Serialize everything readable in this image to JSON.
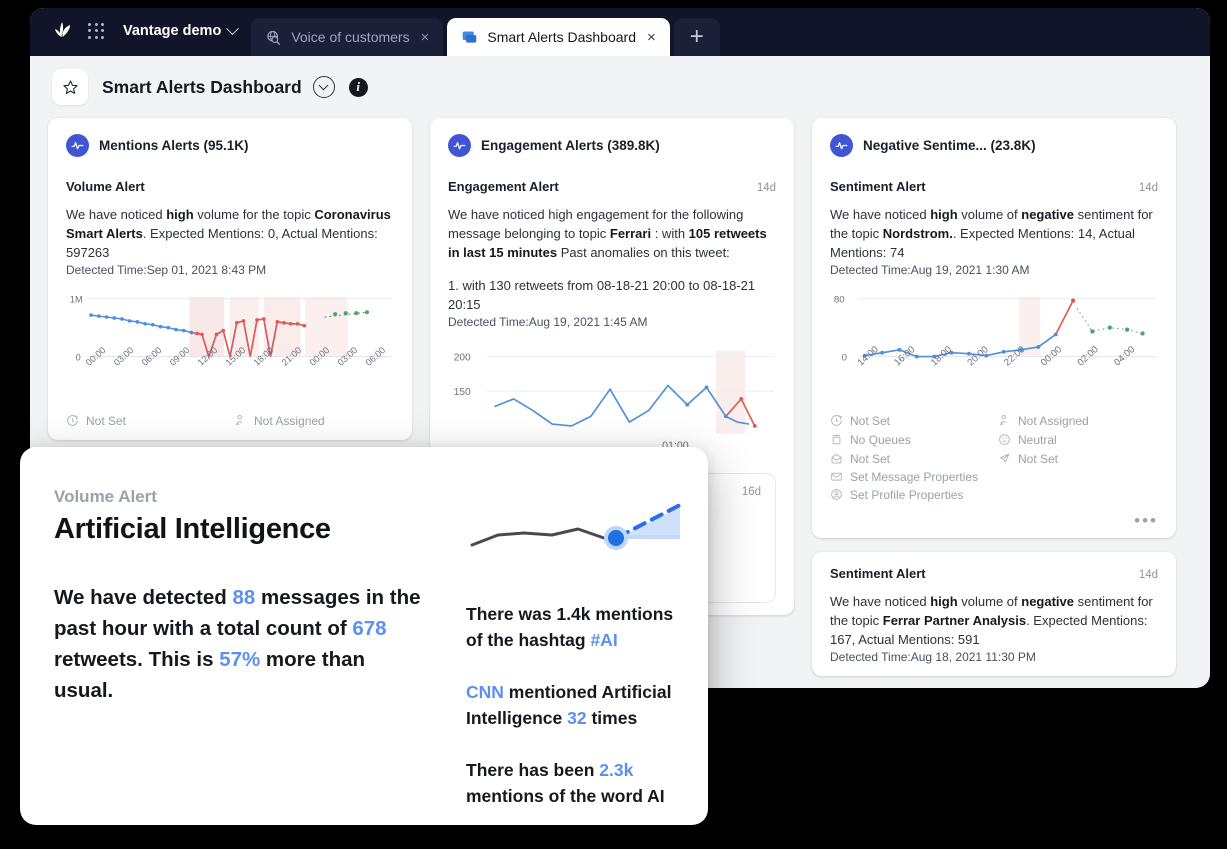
{
  "browser": {
    "workspace": {
      "label": "Vantage demo",
      "icon": "chevron-down-icon"
    },
    "logo_name": "sprinklr-logo",
    "apps_grid_name": "apps-grid-icon",
    "tabs": [
      {
        "label": "Voice of customers",
        "icon": "globe-search-icon",
        "active": false,
        "close": "×"
      },
      {
        "label": "Smart Alerts Dashboard",
        "icon": "chat-bubble-icon",
        "active": true,
        "close": "×"
      }
    ],
    "new_tab_label": "+"
  },
  "header": {
    "star_icon": "star-outline-icon",
    "title": "Smart Alerts Dashboard",
    "dropdown_icon": "chevron-down-circle-icon",
    "info_label": "i"
  },
  "columns": [
    {
      "id": "mentions",
      "head_title": "Mentions Alerts (95.1K)",
      "cards": [
        {
          "kind": "Volume Alert",
          "age": "",
          "body_parts": [
            {
              "t": "We have noticed ",
              "b": false
            },
            {
              "t": "high",
              "b": true
            },
            {
              "t": " volume for the topic ",
              "b": false
            },
            {
              "t": "Coronavirus Smart Alerts",
              "b": true
            },
            {
              "t": ". Expected Mentions: 0, Actual Mentions: 597263",
              "b": false
            }
          ],
          "detected": "Detected Time:Sep 01, 2021 8:43 PM",
          "meta_left": [
            {
              "icon": "clock-arrow-icon",
              "label": "Not Set"
            }
          ],
          "meta_right": [
            {
              "icon": "person-assign-icon",
              "label": "Not Assigned"
            }
          ]
        }
      ]
    },
    {
      "id": "engagement",
      "head_title": "Engagement Alerts (389.8K)",
      "cards": [
        {
          "kind": "Engagement Alert",
          "age": "14d",
          "body_parts": [
            {
              "t": "We have noticed high engagement for the following message belonging to topic ",
              "b": false
            },
            {
              "t": "Ferrari",
              "b": true
            },
            {
              "t": " :  with ",
              "b": false
            },
            {
              "t": "105 retweets in last 15 minutes",
              "b": true
            },
            {
              "t": "\nPast anomalies on this tweet:",
              "b": false
            }
          ],
          "anomaly": "1.  with 130 retweets from 08-18-21 20:00 to 08-18-21 20:15",
          "detected": "Detected Time:Aug 19, 2021 1:45 AM",
          "inner_quote": {
            "age": "16d",
            "link": "mZb"
          }
        }
      ]
    },
    {
      "id": "negative-sentiment",
      "head_title": "Negative Sentime...   (23.8K)",
      "cards": [
        {
          "kind": "Sentiment Alert",
          "age": "14d",
          "body_parts": [
            {
              "t": "We have noticed ",
              "b": false
            },
            {
              "t": "high",
              "b": true
            },
            {
              "t": " volume of ",
              "b": false
            },
            {
              "t": "negative",
              "b": true
            },
            {
              "t": " sentiment for the topic ",
              "b": false
            },
            {
              "t": "Nordstrom.",
              "b": true
            },
            {
              "t": ". Expected Mentions: 14, Actual Mentions: 74",
              "b": false
            }
          ],
          "detected": "Detected Time:Aug 19, 2021 1:30 AM",
          "meta_left": [
            {
              "icon": "clock-arrow-icon",
              "label": "Not Set"
            },
            {
              "icon": "queue-icon",
              "label": "No Queues"
            },
            {
              "icon": "inbox-icon",
              "label": "Not Set"
            }
          ],
          "meta_right": [
            {
              "icon": "person-assign-icon",
              "label": "Not Assigned"
            },
            {
              "icon": "neutral-face-icon",
              "label": "Neutral"
            },
            {
              "icon": "paper-plane-icon",
              "label": "Not Set"
            }
          ],
          "meta_full": [
            {
              "icon": "envelope-icon",
              "label": "Set Message Properties"
            },
            {
              "icon": "user-circle-icon",
              "label": "Set Profile Properties"
            }
          ],
          "more_label": "•••"
        },
        {
          "kind": "Sentiment Alert",
          "age": "14d",
          "body_parts": [
            {
              "t": "We have noticed ",
              "b": false
            },
            {
              "t": "high",
              "b": true
            },
            {
              "t": " volume of ",
              "b": false
            },
            {
              "t": "negative",
              "b": true
            },
            {
              "t": " sentiment for the topic ",
              "b": false
            },
            {
              "t": "Ferrar Partner Analysis",
              "b": true
            },
            {
              "t": ". Expected Mentions: 167, Actual Mentions: 591",
              "b": false
            }
          ],
          "detected": "Detected Time:Aug 18, 2021 11:30 PM"
        }
      ]
    }
  ],
  "overlay": {
    "kicker": "Volume Alert",
    "title": "Artificial Intelligence",
    "paragraph": [
      {
        "t": "We have detected ",
        "hl": false
      },
      {
        "t": "88",
        "hl": true
      },
      {
        "t": " messages in the past hour with a total count of ",
        "hl": false
      },
      {
        "t": "678",
        "hl": true
      },
      {
        "t": " retweets. This is ",
        "hl": false
      },
      {
        "t": "57%",
        "hl": true
      },
      {
        "t": " more than usual.",
        "hl": false
      }
    ],
    "sparkline_name": "trend-sparkline",
    "stats": [
      [
        {
          "t": "There was 1.4k mentions of the hashtag ",
          "hl": false
        },
        {
          "t": "#AI",
          "hl": true
        }
      ],
      [
        {
          "t": "CNN",
          "hl": true
        },
        {
          "t": " mentioned Artificial Intelligence ",
          "hl": false
        },
        {
          "t": "32",
          "hl": true
        },
        {
          "t": " times",
          "hl": false
        }
      ],
      [
        {
          "t": "There has been ",
          "hl": false
        },
        {
          "t": "2.3k",
          "hl": true
        },
        {
          "t": " mentions of the word AI",
          "hl": false
        }
      ]
    ]
  },
  "colors": {
    "accent_blue": "#4155d4",
    "link_blue": "#4468d8",
    "highlight_blue": "#5b8ff0",
    "line_blue": "#4e90d9",
    "line_red": "#e05a52",
    "line_green": "#4aa663",
    "tabbar_dark": "#12152a",
    "page_bg": "#f2f3f5"
  },
  "chart_data": [
    {
      "id": "mentions-volume-chart",
      "type": "line",
      "title": "",
      "ylabel": "",
      "xlabel": "",
      "ytick_labels": [
        "1M",
        "0"
      ],
      "ylim": [
        0,
        1000000
      ],
      "categories": [
        "00:00",
        "03:00",
        "06:00",
        "09:00",
        "12:00",
        "15:00",
        "18:00",
        "21:00",
        "00:00",
        "03:00",
        "06:00"
      ],
      "series": [
        {
          "name": "actual-blue",
          "color": "#4e90d9",
          "values": [
            680000,
            660000,
            640000,
            620000,
            600000,
            580000,
            565000,
            545000,
            530000,
            510000,
            490000,
            470000,
            450000,
            430000,
            410000,
            395000,
            380000,
            370000,
            0,
            480000,
            530000,
            0,
            620000,
            660000,
            0,
            700000,
            720000,
            0,
            660000,
            640000,
            630000,
            615000,
            600000
          ]
        },
        {
          "name": "anomaly-red",
          "color": "#e05a52",
          "values": [
            null,
            null,
            null,
            null,
            null,
            null,
            null,
            null,
            null,
            null,
            null,
            null,
            null,
            null,
            null,
            380000,
            370000,
            0,
            null,
            480000,
            530000,
            null,
            620000,
            660000,
            null,
            700000,
            720000,
            null,
            660000,
            640000,
            630000,
            615000,
            600000
          ]
        },
        {
          "name": "forecast-green",
          "color": "#4aa663",
          "values": [
            720000,
            735000,
            735000,
            740000
          ]
        }
      ],
      "anomaly_bands": [
        "12:00-05:00"
      ]
    },
    {
      "id": "engagement-chart",
      "type": "line",
      "ytick_labels": [
        "200",
        "150"
      ],
      "ylim": [
        0,
        200
      ],
      "categories": [
        "01:00"
      ],
      "series": [
        {
          "name": "actual-blue",
          "color": "#4e90d9",
          "values": [
            135,
            143,
            132,
            120,
            118,
            125,
            147,
            120,
            128,
            150,
            131,
            148,
            122,
            118,
            116
          ]
        },
        {
          "name": "anomaly-red",
          "color": "#e05a52",
          "values": [
            null,
            null,
            null,
            null,
            null,
            null,
            null,
            null,
            null,
            null,
            null,
            null,
            116,
            133,
            108
          ]
        }
      ]
    },
    {
      "id": "negative-sentiment-chart",
      "type": "line",
      "ytick_labels": [
        "80",
        "0"
      ],
      "ylim": [
        0,
        80
      ],
      "categories": [
        "14:00",
        "16:00",
        "18:00",
        "20:00",
        "22:00",
        "00:00",
        "02:00",
        "04:00"
      ],
      "series": [
        {
          "name": "actual-blue",
          "color": "#4e90d9",
          "values": [
            2,
            6,
            9,
            1,
            0,
            6,
            5,
            3,
            6,
            8,
            12,
            23
          ]
        },
        {
          "name": "anomaly-red",
          "color": "#e05a52",
          "values": [
            null,
            null,
            null,
            null,
            null,
            null,
            null,
            null,
            null,
            null,
            null,
            23,
            74
          ]
        },
        {
          "name": "forecast-green",
          "color": "#4aa663",
          "values": [
            18,
            20,
            19,
            16
          ]
        }
      ]
    },
    {
      "id": "overlay-sparkline",
      "type": "line",
      "series": [
        {
          "name": "history",
          "color": "#4a4a4a",
          "values": [
            10,
            22,
            25,
            23,
            27,
            20,
            20,
            20
          ]
        },
        {
          "name": "projection",
          "color": "#2b6fe8",
          "values": [
            20,
            44
          ]
        }
      ]
    }
  ]
}
